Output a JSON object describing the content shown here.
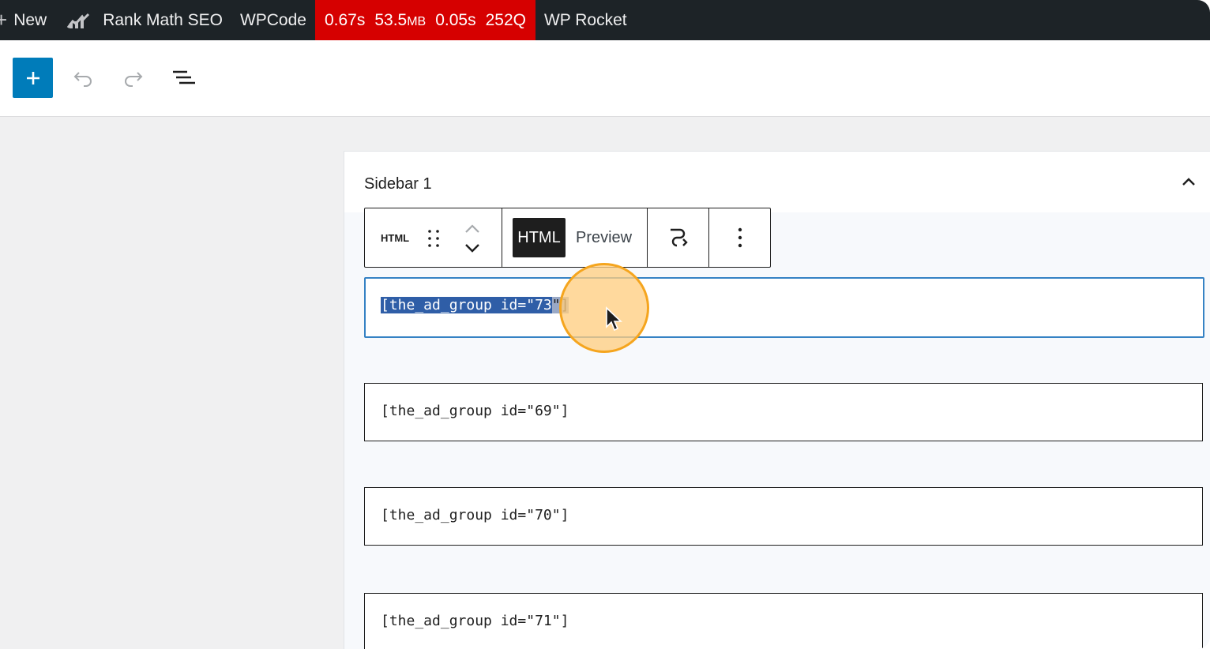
{
  "admin_bar": {
    "new_label": "New",
    "rank_math_label": "Rank Math SEO",
    "wpcode_label": "WPCode",
    "perf": {
      "time": "0.67s",
      "memory_value": "53.5",
      "memory_unit": "MB",
      "query_time": "0.05s",
      "queries": "252Q"
    },
    "wp_rocket_label": "WP Rocket"
  },
  "editor_toolbar": {
    "add_block_icon": "plus-icon",
    "undo_icon": "undo-icon",
    "redo_icon": "redo-icon",
    "list_view_icon": "list-view-icon"
  },
  "panel": {
    "title": "Sidebar 1",
    "collapse_icon": "chevron-up-icon"
  },
  "block_toolbar": {
    "block_type_label": "HTML",
    "drag_icon": "drag-handle-icon",
    "move_icon": "move-up-down-icon",
    "mode_html_label": "HTML",
    "mode_preview_label": "Preview",
    "transform_icon": "transform-icon",
    "options_icon": "more-options-icon"
  },
  "blocks": [
    {
      "code_selected": "[the_ad_group id=\"73",
      "code_selected_end": "\"]",
      "active": true
    },
    {
      "code": "[the_ad_group id=\"69\"]"
    },
    {
      "code": "[the_ad_group id=\"70\"]"
    },
    {
      "code": "[the_ad_group id=\"71\"]"
    }
  ],
  "colors": {
    "admin_bar": "#1d2327",
    "perf_bg": "#d60000",
    "accent": "#007cba",
    "cursor_ring": "#f5a51e"
  }
}
